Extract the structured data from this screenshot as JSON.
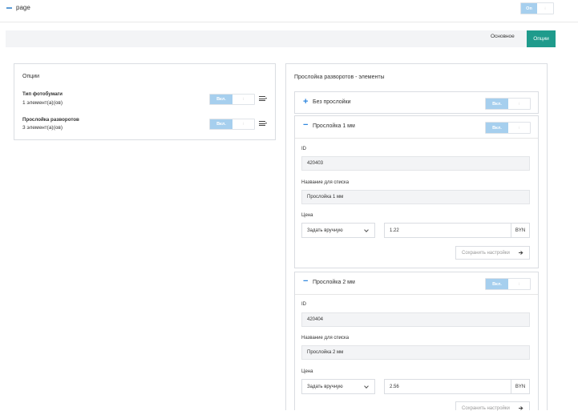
{
  "header": {
    "title": "page",
    "toggle_on": "On",
    "toggle_off": ""
  },
  "nav": {
    "tab_main": "Основное",
    "tab_options": "Опции"
  },
  "left": {
    "title": "Опции",
    "items": [
      {
        "title": "Тип фотобумаги",
        "subtitle": "1 элемент(а)(ов)",
        "toggle_on": "Вкл."
      },
      {
        "title": "Прослойка разворотов",
        "subtitle": "3 элемент(а)(ов)",
        "toggle_on": "Вкл."
      }
    ]
  },
  "right": {
    "title": "Прослойка разворотов - элементы",
    "sections": [
      {
        "label": "Без прослойки",
        "expanded": false,
        "toggle_on": "Вкл."
      },
      {
        "label": "Прослойка 1 мм",
        "expanded": true,
        "toggle_on": "Вкл.",
        "id_label": "ID",
        "id_value": "420403",
        "name_label": "Название для списка",
        "name_value": "Прослойка 1 мм",
        "price_label": "Цена",
        "price_mode": "Задать вручную",
        "price_value": "1.22",
        "currency": "BYN",
        "save_label": "Сохранить настройки"
      },
      {
        "label": "Прослойка 2 мм",
        "expanded": true,
        "toggle_on": "Вкл.",
        "id_label": "ID",
        "id_value": "420404",
        "name_label": "Название для списка",
        "name_value": "Прослойка 2 мм",
        "price_label": "Цена",
        "price_mode": "Задать вручную",
        "price_value": "2.56",
        "currency": "BYN",
        "save_label": "Сохранить настройки"
      }
    ]
  },
  "colors": {
    "accent_teal": "#1f9b8c",
    "toggle_on": "#a6cfee",
    "plus_minus": "#2e86de"
  }
}
